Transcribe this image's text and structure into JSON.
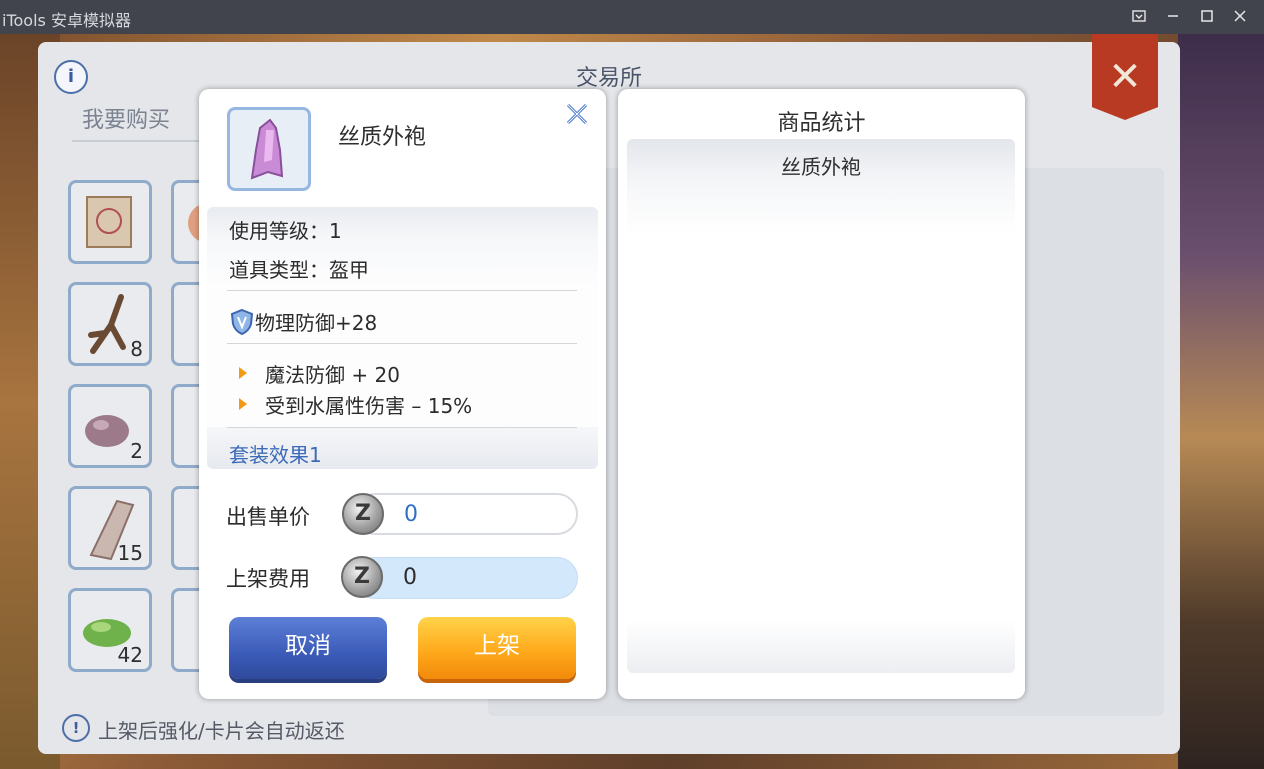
{
  "window": {
    "title": "iTools 安卓模拟器"
  },
  "exchange": {
    "title": "交易所",
    "tab_label": "我要购买",
    "notice": "上架后强化/卡片会自动返还",
    "slot_counts": [
      "8",
      "2",
      "15",
      "42"
    ]
  },
  "detail": {
    "item_name": "丝质外袍",
    "level_label": "使用等级：",
    "level_value": "1",
    "type_label": "道具类型：",
    "type_value": "盔甲",
    "physical_defense": "物理防御+28",
    "bonuses": [
      "魔法防御 + 20",
      "受到水属性伤害 – 15%"
    ],
    "set_effect": "套装效果1",
    "unit_price_label": "出售单价",
    "unit_price_value": "0",
    "listing_fee_label": "上架费用",
    "listing_fee_value": "0",
    "cancel_label": "取消",
    "confirm_label": "上架"
  },
  "stats": {
    "title": "商品统计",
    "items": [
      "丝质外袍"
    ]
  },
  "colors": {
    "accent_blue": "#3a6fc7",
    "set_effect_blue": "#3b6ab7",
    "price_blue": "#2f6fc4",
    "confirm_orange": "#ffaa1c",
    "cancel_blue": "#3b5bb8"
  },
  "icons": {
    "close_dialog": "close-x-icon",
    "info": "info-icon",
    "coin": "zeny-coin-icon",
    "defense": "shield-icon",
    "bullet": "orange-triangle-icon"
  }
}
